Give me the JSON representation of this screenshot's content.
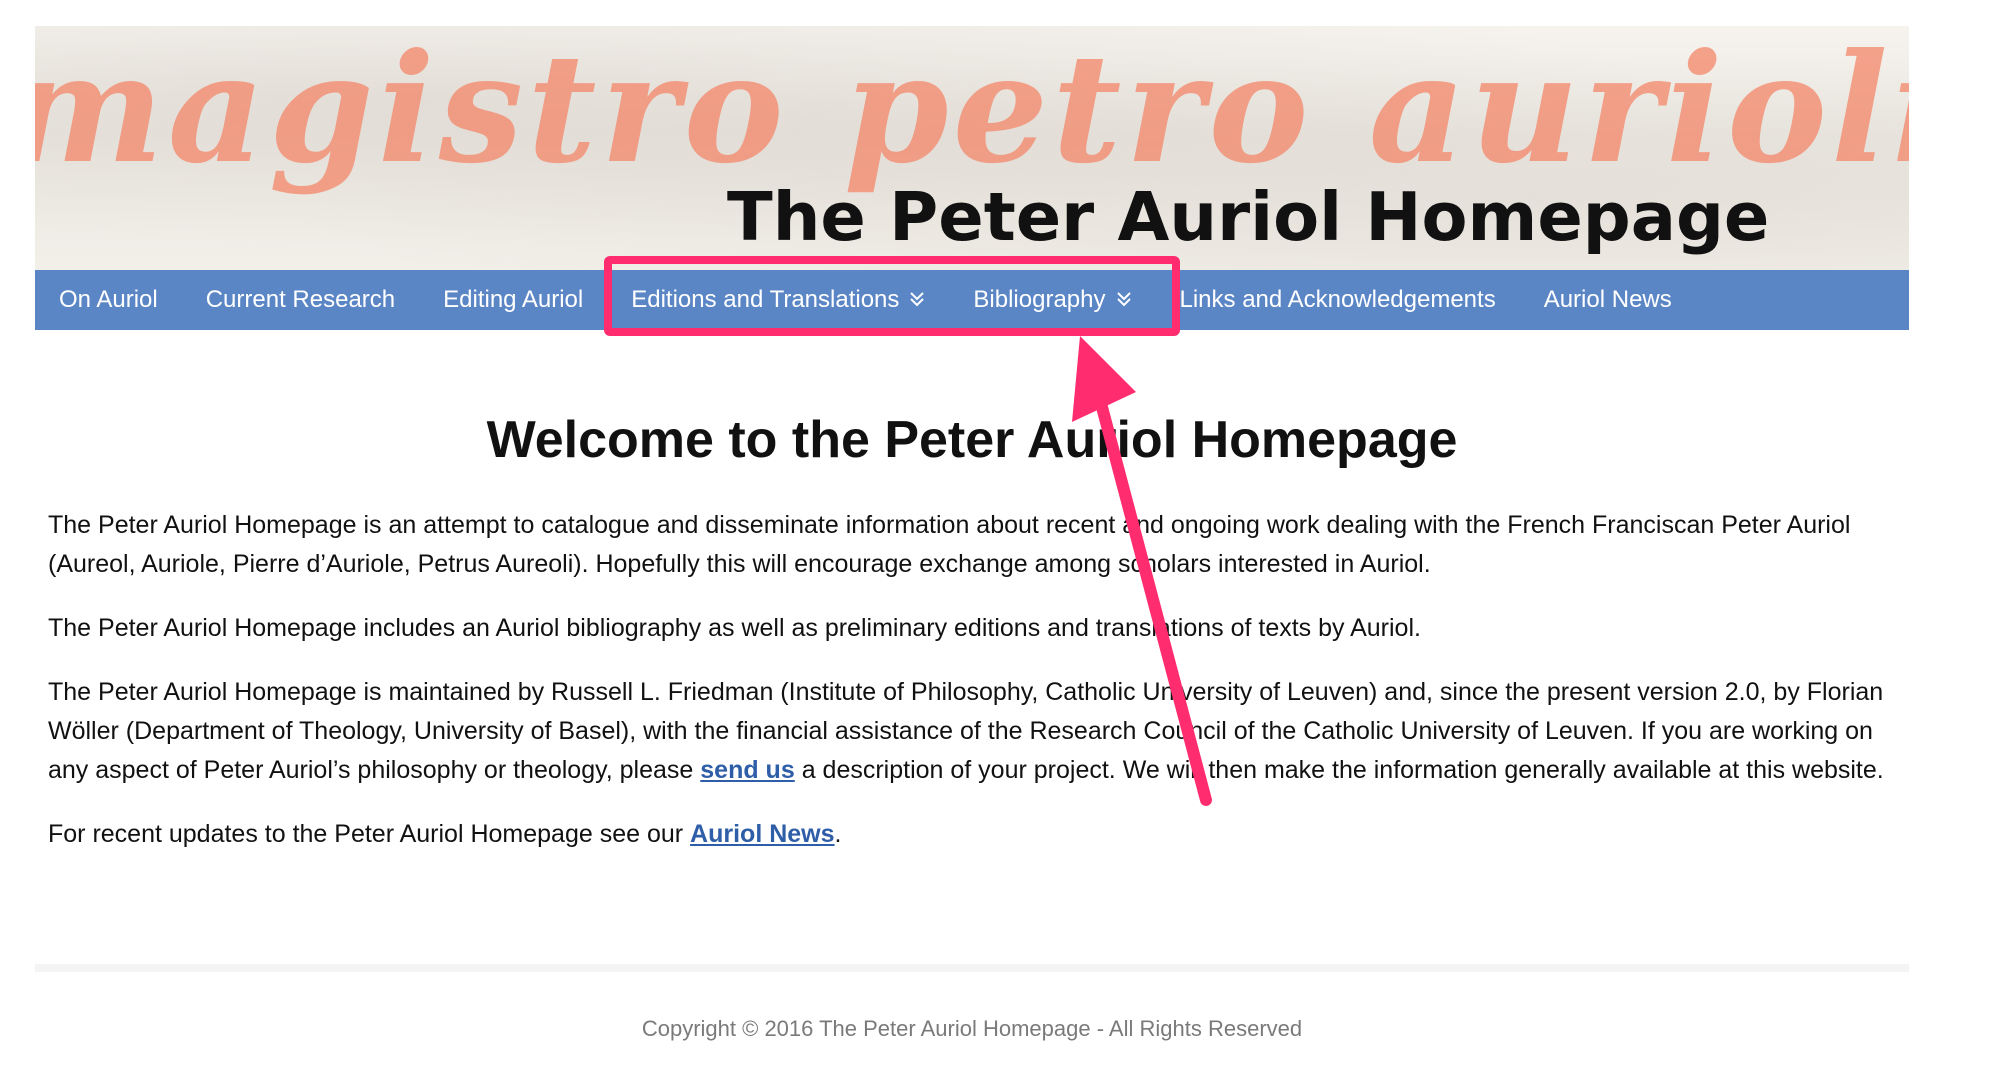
{
  "banner": {
    "script_text": "magistro petro aurioli do",
    "title": "The Peter Auriol Homepage"
  },
  "nav": {
    "items": [
      {
        "label": "On Auriol"
      },
      {
        "label": "Current Research"
      },
      {
        "label": "Editing Auriol"
      },
      {
        "label": "Editions and Translations",
        "dropdown": true
      },
      {
        "label": "Bibliography",
        "dropdown": true
      },
      {
        "label": "Links and Acknowledgements"
      },
      {
        "label": "Auriol News"
      }
    ],
    "dropdown_glyph": "»"
  },
  "annotation": {
    "color": "#ff2d6f"
  },
  "main": {
    "title": "Welcome to the Peter Auriol Homepage",
    "p1": "The Peter Auriol Homepage is an attempt to catalogue and disseminate information about recent and ongoing work dealing with the French Franciscan Peter Auriol (Aureol, Auriole, Pierre d’Auriole, Petrus Aureoli). Hopefully this will encourage exchange among scholars interested in Auriol.",
    "p2": "The Peter Auriol Homepage includes an Auriol bibliography as well as preliminary editions and translations of texts by Auriol.",
    "p3_before": "The Peter Auriol Homepage is maintained by Russell L. Friedman (Institute of Philosophy, Catholic University of Leuven) and, since the present version 2.0, by Florian Wöller (Department of Theology, University of Basel), with the financial assistance of the Research Council of the Catholic University of Leuven. If you are working on any aspect of Peter Auriol’s philosophy or theology, please ",
    "p3_link": "send us",
    "p3_after": " a description of your project. We will then make the information generally available at this website.",
    "p4_before": "For recent updates to the Peter Auriol Homepage see our ",
    "p4_link": "Auriol News",
    "p4_after": "."
  },
  "footer": {
    "text": "Copyright © 2016 The Peter Auriol Homepage - All Rights Reserved"
  },
  "colors": {
    "nav_bg": "#5b86c6",
    "link": "#2f5ea8",
    "banner_script": "#f5876a"
  }
}
